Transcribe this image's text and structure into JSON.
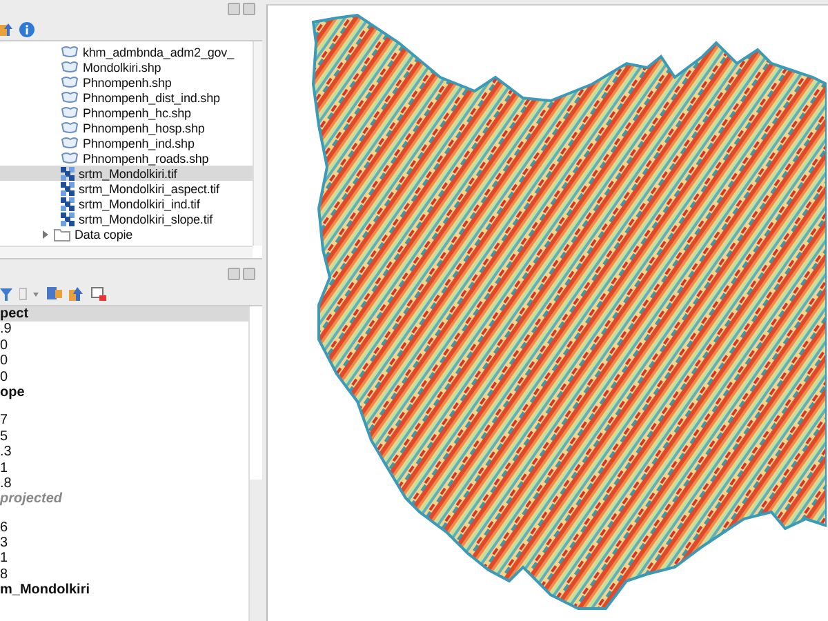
{
  "browser": {
    "items": [
      {
        "label": "khm_admbnda_adm2_gov_",
        "kind": "vector",
        "selected": false
      },
      {
        "label": "Mondolkiri.shp",
        "kind": "vector",
        "selected": false
      },
      {
        "label": "Phnompenh.shp",
        "kind": "vector",
        "selected": false
      },
      {
        "label": "Phnompenh_dist_ind.shp",
        "kind": "vector",
        "selected": false
      },
      {
        "label": "Phnompenh_hc.shp",
        "kind": "vector",
        "selected": false
      },
      {
        "label": "Phnompenh_hosp.shp",
        "kind": "vector",
        "selected": false
      },
      {
        "label": "Phnompenh_ind.shp",
        "kind": "vector",
        "selected": false
      },
      {
        "label": "Phnompenh_roads.shp",
        "kind": "vector",
        "selected": false
      },
      {
        "label": "srtm_Mondolkiri.tif",
        "kind": "raster",
        "selected": true
      },
      {
        "label": "srtm_Mondolkiri_aspect.tif",
        "kind": "raster",
        "selected": false
      },
      {
        "label": "srtm_Mondolkiri_ind.tif",
        "kind": "raster",
        "selected": false
      },
      {
        "label": "srtm_Mondolkiri_slope.tif",
        "kind": "raster",
        "selected": false
      },
      {
        "label": "Data copie",
        "kind": "folder",
        "selected": false
      }
    ]
  },
  "layers": {
    "items": [
      {
        "label": "pect",
        "kind": "header",
        "selected": true
      },
      {
        "label": ".9",
        "kind": "value",
        "selected": false
      },
      {
        "label": "0",
        "kind": "value",
        "selected": false
      },
      {
        "label": "0",
        "kind": "value",
        "selected": false
      },
      {
        "label": "0",
        "kind": "value",
        "selected": false
      },
      {
        "label": "ope",
        "kind": "header",
        "selected": false
      },
      {
        "label": "7",
        "kind": "value",
        "selected": false,
        "gap_before": true
      },
      {
        "label": "5",
        "kind": "value",
        "selected": false
      },
      {
        "label": ".3",
        "kind": "value",
        "selected": false
      },
      {
        "label": "1",
        "kind": "value",
        "selected": false
      },
      {
        "label": ".8",
        "kind": "value",
        "selected": false
      },
      {
        "label": "projected",
        "kind": "note",
        "selected": false
      },
      {
        "label": "6",
        "kind": "value",
        "selected": false,
        "gap_before": true
      },
      {
        "label": "3",
        "kind": "value",
        "selected": false
      },
      {
        "label": "1",
        "kind": "value",
        "selected": false
      },
      {
        "label": "8",
        "kind": "value",
        "selected": false
      },
      {
        "label": "m_Mondolkiri",
        "kind": "header",
        "selected": false
      }
    ]
  }
}
